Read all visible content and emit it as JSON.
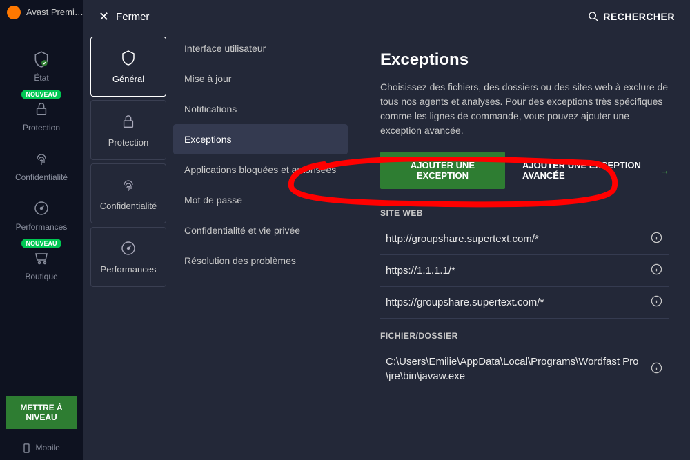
{
  "app": {
    "title": "Avast Premi…"
  },
  "modal": {
    "close": "Fermer",
    "search": "RECHERCHER"
  },
  "rail": {
    "items": [
      {
        "label": "État",
        "icon": "shield-check",
        "badge": null
      },
      {
        "label": "Protection",
        "icon": "lock",
        "badge": "NOUVEAU"
      },
      {
        "label": "Confidentialité",
        "icon": "fingerprint",
        "badge": null
      },
      {
        "label": "Performances",
        "icon": "gauge",
        "badge": null
      },
      {
        "label": "Boutique",
        "icon": "cart",
        "badge": "NOUVEAU"
      }
    ],
    "upgrade": "METTRE À NIVEAU",
    "mobile": "Mobile"
  },
  "tabs": [
    {
      "label": "Général",
      "icon": "shield",
      "active": true
    },
    {
      "label": "Protection",
      "icon": "lock",
      "active": false
    },
    {
      "label": "Confidentialité",
      "icon": "fingerprint",
      "active": false
    },
    {
      "label": "Performances",
      "icon": "gauge",
      "active": false
    }
  ],
  "menu": {
    "general": [
      {
        "label": "Interface utilisateur"
      },
      {
        "label": "Mise à jour"
      },
      {
        "label": "Notifications"
      }
    ],
    "protection": [
      {
        "label": "Exceptions",
        "selected": true
      },
      {
        "label": "Applications bloquées et autorisées"
      }
    ],
    "privacy": [
      {
        "label": "Mot de passe"
      },
      {
        "label": "Confidentialité et vie privée"
      }
    ],
    "perf": [
      {
        "label": "Résolution des problèmes"
      }
    ]
  },
  "content": {
    "title": "Exceptions",
    "description": "Choisissez des fichiers, des dossiers ou des sites web à exclure de tous nos agents et analyses. Pour des exceptions très spécifiques comme les lignes de commande, vous pouvez ajouter une exception avancée.",
    "btn_add": "AJOUTER UNE EXCEPTION",
    "btn_advanced": "AJOUTER UNE EXCEPTION AVANCÉE",
    "section_web": "SITE WEB",
    "section_file": "FICHIER/DOSSIER",
    "web_exceptions": [
      "http://groupshare.supertext.com/*",
      "https://1.1.1.1/*",
      "https://groupshare.supertext.com/*"
    ],
    "file_exceptions": [
      "C:\\Users\\Emilie\\AppData\\Local\\Programs\\Wordfast Pro\\jre\\bin\\javaw.exe"
    ]
  }
}
